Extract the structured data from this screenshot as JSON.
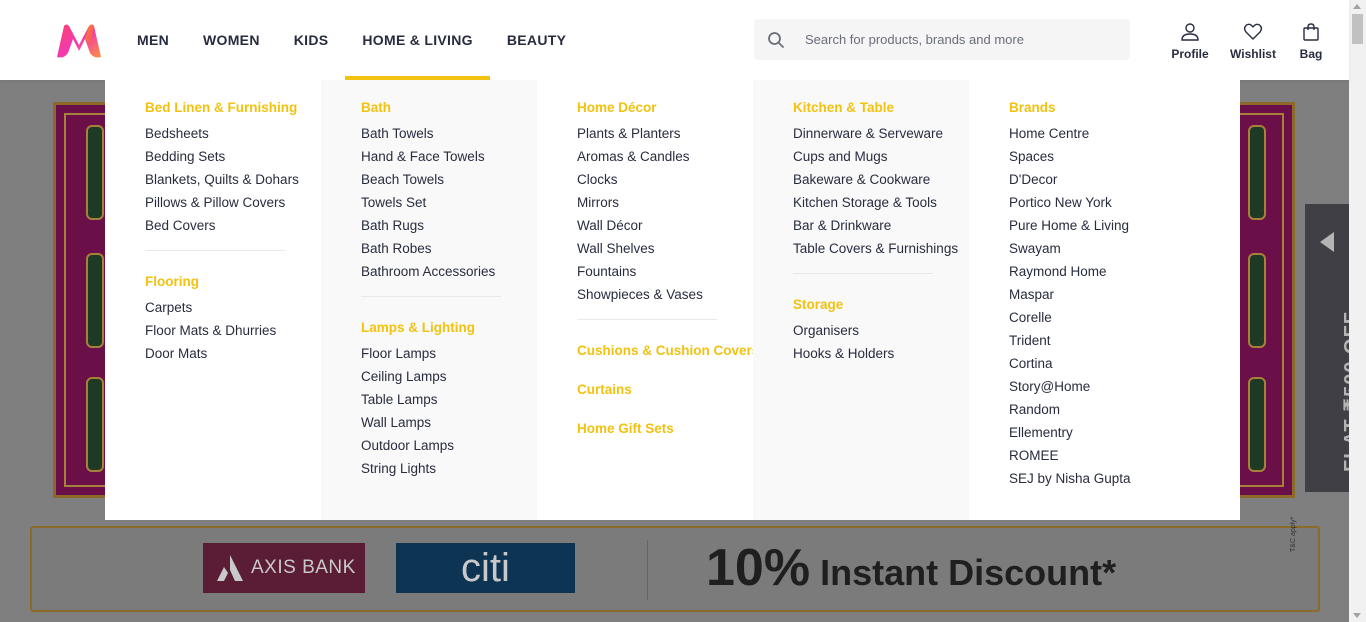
{
  "header": {
    "nav": [
      "MEN",
      "WOMEN",
      "KIDS",
      "HOME & LIVING",
      "BEAUTY"
    ],
    "search_placeholder": "Search for products, brands and more",
    "actions": {
      "profile": "Profile",
      "wishlist": "Wishlist",
      "bag": "Bag"
    }
  },
  "menu": {
    "col1": {
      "bed_linen": {
        "title": "Bed Linen & Furnishing",
        "items": [
          "Bedsheets",
          "Bedding Sets",
          "Blankets, Quilts & Dohars",
          "Pillows & Pillow Covers",
          "Bed Covers"
        ]
      },
      "flooring": {
        "title": "Flooring",
        "items": [
          "Carpets",
          "Floor Mats & Dhurries",
          "Door Mats"
        ]
      }
    },
    "col2": {
      "bath": {
        "title": "Bath",
        "items": [
          "Bath Towels",
          "Hand & Face Towels",
          "Beach Towels",
          "Towels Set",
          "Bath Rugs",
          "Bath Robes",
          "Bathroom Accessories"
        ]
      },
      "lamps": {
        "title": "Lamps & Lighting",
        "items": [
          "Floor Lamps",
          "Ceiling Lamps",
          "Table Lamps",
          "Wall Lamps",
          "Outdoor Lamps",
          "String Lights"
        ]
      }
    },
    "col3": {
      "decor": {
        "title": "Home Décor",
        "items": [
          "Plants & Planters",
          "Aromas & Candles",
          "Clocks",
          "Mirrors",
          "Wall Décor",
          "Wall Shelves",
          "Fountains",
          "Showpieces & Vases"
        ]
      },
      "cushions": "Cushions & Cushion Covers",
      "curtains": "Curtains",
      "gift_sets": "Home Gift Sets"
    },
    "col4": {
      "kitchen": {
        "title": "Kitchen & Table",
        "items": [
          "Dinnerware & Serveware",
          "Cups and Mugs",
          "Bakeware & Cookware",
          "Kitchen Storage & Tools",
          "Bar & Drinkware",
          "Table Covers & Furnishings"
        ]
      },
      "storage": {
        "title": "Storage",
        "items": [
          "Organisers",
          "Hooks & Holders"
        ]
      }
    },
    "col5": {
      "brands": {
        "title": "Brands",
        "items": [
          "Home Centre",
          "Spaces",
          "D'Decor",
          "Portico New York",
          "Pure Home & Living",
          "Swayam",
          "Raymond Home",
          "Maspar",
          "Corelle",
          "Trident",
          "Cortina",
          "Story@Home",
          "Random",
          "Ellementry",
          "ROMEE",
          "SEJ by Nisha Gupta"
        ]
      }
    }
  },
  "promo": {
    "axis_bank": "AXIS BANK",
    "citi": "citi",
    "discount_pct": "10%",
    "discount_text": "Instant Discount*",
    "tc": "T&C apply*",
    "side_offer": "FLAT ₹500 OFF"
  },
  "colors": {
    "accent": "#f2c210",
    "text": "#282c3f",
    "overlay": "#7f7f7f"
  }
}
